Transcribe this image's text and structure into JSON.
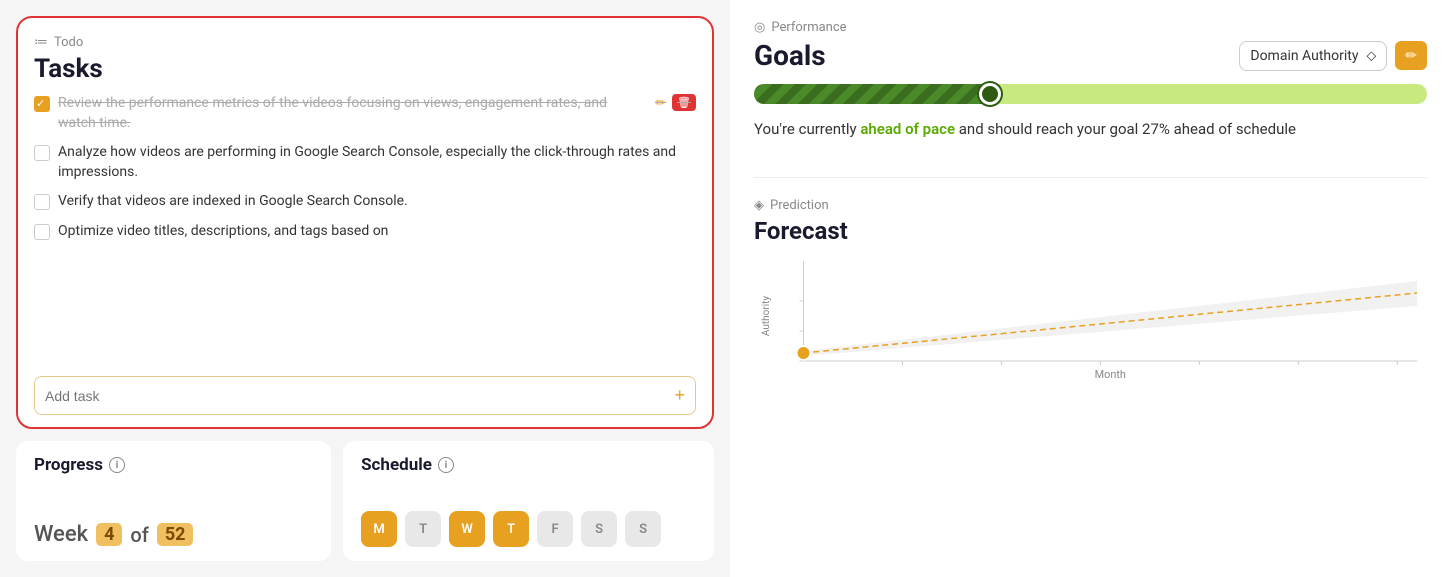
{
  "todo": {
    "header_label": "Todo",
    "title": "Tasks",
    "tasks": [
      {
        "id": 1,
        "text": "Review the performance metrics of the videos focusing on views, engagement rates, and watch time.",
        "completed": true,
        "has_actions": true
      },
      {
        "id": 2,
        "text": "Analyze how videos are performing in Google Search Console, especially the click-through rates and impressions.",
        "completed": false,
        "has_actions": false
      },
      {
        "id": 3,
        "text": "Verify that videos are indexed in Google Search Console.",
        "completed": false,
        "has_actions": false
      },
      {
        "id": 4,
        "text": "Optimize video titles, descriptions, and tags based on",
        "completed": false,
        "has_actions": false
      }
    ],
    "add_task_placeholder": "Add task"
  },
  "progress": {
    "title": "Progress",
    "week_label": "Week",
    "week_value": "4",
    "of_label": "of",
    "total_value": "52"
  },
  "schedule": {
    "title": "Schedule",
    "days": [
      {
        "label": "M",
        "active": true
      },
      {
        "label": "T",
        "active": false
      },
      {
        "label": "W",
        "active": true
      },
      {
        "label": "T",
        "active": true
      },
      {
        "label": "F",
        "active": false
      },
      {
        "label": "S",
        "active": false
      },
      {
        "label": "S",
        "active": false
      }
    ]
  },
  "goals": {
    "section_label": "Performance",
    "title": "Goals",
    "dropdown_label": "Domain Authority",
    "edit_icon": "✏",
    "bar_fill_pct": 35,
    "status_text_prefix": "You're currently ",
    "status_highlight": "ahead of pace",
    "status_text_suffix": " and should reach your goal 27% ahead of schedule"
  },
  "forecast": {
    "section_label": "Prediction",
    "title": "Forecast",
    "x_axis_label": "Month",
    "y_axis_label": "Authority"
  }
}
